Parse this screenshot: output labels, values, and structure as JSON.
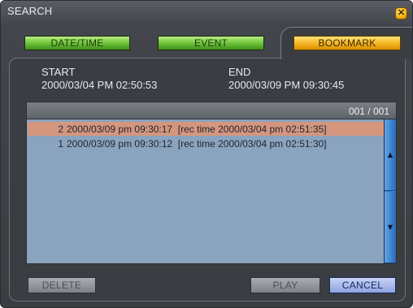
{
  "window": {
    "title": "SEARCH"
  },
  "tabs": [
    {
      "label": "DATE/TIME",
      "active": false
    },
    {
      "label": "EVENT",
      "active": false
    },
    {
      "label": "BOOKMARK",
      "active": true
    }
  ],
  "range": {
    "start_label": "START",
    "start_value": "2000/03/04 PM 02:50:53",
    "end_label": "END",
    "end_value": "2000/03/09 PM 09:30:45"
  },
  "list": {
    "page_indicator": "001 / 001",
    "rows": [
      {
        "num": "2",
        "text": "2000/03/09 pm 09:30:17  [rec time 2000/03/04 pm 02:51:35]",
        "selected": true
      },
      {
        "num": "1",
        "text": "2000/03/09 pm 09:30:12  [rec time 2000/03/04 pm 02:51:30]",
        "selected": false
      }
    ]
  },
  "buttons": {
    "delete": "DELETE",
    "play": "PLAY",
    "cancel": "CANCEL"
  },
  "icons": {
    "close": "close-icon",
    "scroll_up": "arrow-up-icon",
    "scroll_down": "arrow-down-icon"
  },
  "colors": {
    "tab_green": "#6ec43a",
    "tab_active": "#f7b826",
    "list_bg": "#8aa3be",
    "row_selected": "#d5967e",
    "scrollbar": "#3a7fce"
  }
}
